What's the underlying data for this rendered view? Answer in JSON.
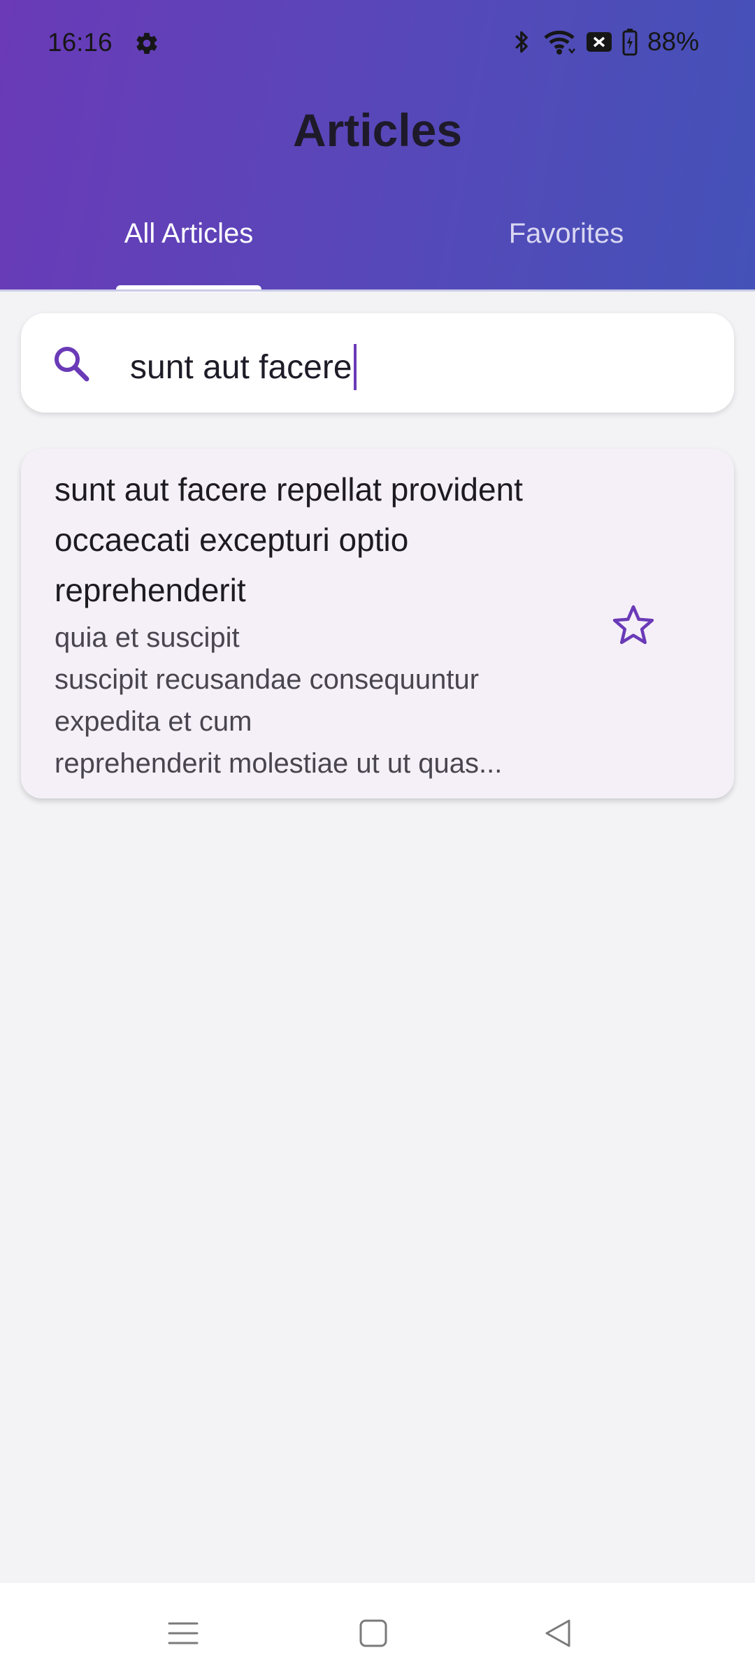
{
  "status_bar": {
    "time": "16:16",
    "battery": "88%",
    "icons": [
      "settings-icon",
      "bluetooth-icon",
      "wifi-icon",
      "nfc-icon",
      "battery-icon"
    ]
  },
  "app": {
    "title": "Articles"
  },
  "tabs": [
    {
      "label": "All Articles",
      "selected": true
    },
    {
      "label": "Favorites",
      "selected": false
    }
  ],
  "search": {
    "icon": "search-icon",
    "value": "sunt aut facere"
  },
  "articles": [
    {
      "title": "sunt aut facere repellat provident occaecati excepturi optio reprehenderit",
      "body": "quia et suscipit\nsuscipit recusandae consequuntur expedita et cum\nreprehenderit molestiae ut ut quas...",
      "favorite": false,
      "favorite_icon": "star-outline-icon"
    }
  ],
  "nav_bar": {
    "buttons": [
      "menu-icon",
      "home-icon",
      "back-icon"
    ]
  },
  "colors": {
    "header_gradient_start": "#6a3ab7",
    "header_gradient_end": "#4452b8",
    "accent": "#6a3ab7",
    "card_background": "#f5f0f8",
    "page_background": "#f3f3f5"
  }
}
